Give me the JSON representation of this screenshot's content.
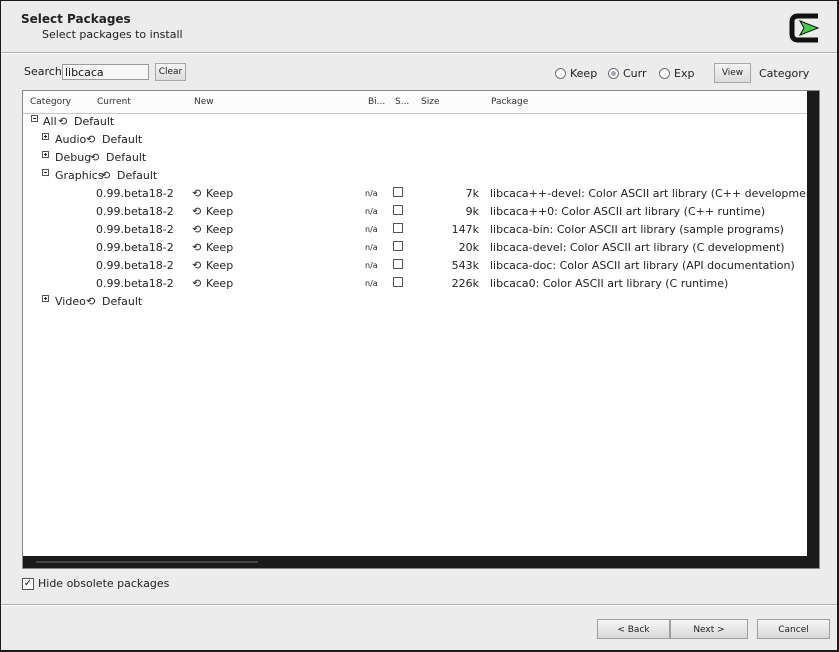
{
  "header": {
    "title": "Select Packages",
    "subtitle": "Select packages to install"
  },
  "toolbar": {
    "search_label": "Search",
    "search_value": "libcaca",
    "clear_label": "Clear",
    "view_options": [
      {
        "label": "Keep",
        "selected": false
      },
      {
        "label": "Curr",
        "selected": true
      },
      {
        "label": "Exp",
        "selected": false
      }
    ],
    "view_button_label": "View",
    "view_mode": "Category"
  },
  "columns": [
    "Category",
    "Current",
    "New",
    "Bi...",
    "S...",
    "Size",
    "Package"
  ],
  "tree": {
    "root": {
      "label": "All",
      "action": "Default",
      "expanded": true
    },
    "categories": [
      {
        "label": "Audio",
        "action": "Default",
        "expanded": false
      },
      {
        "label": "Debug",
        "action": "Default",
        "expanded": false
      },
      {
        "label": "Graphics",
        "action": "Default",
        "expanded": true
      },
      {
        "label": "Video",
        "action": "Default",
        "expanded": false
      }
    ],
    "packages": [
      {
        "current": "0.99.beta18-2",
        "new": "Keep",
        "bin": "n/a",
        "src": false,
        "size": "7k",
        "package": "libcaca++-devel: Color ASCII art library (C++ development)"
      },
      {
        "current": "0.99.beta18-2",
        "new": "Keep",
        "bin": "n/a",
        "src": false,
        "size": "9k",
        "package": "libcaca++0: Color ASCII art library (C++ runtime)"
      },
      {
        "current": "0.99.beta18-2",
        "new": "Keep",
        "bin": "n/a",
        "src": false,
        "size": "147k",
        "package": "libcaca-bin: Color ASCII art library (sample programs)"
      },
      {
        "current": "0.99.beta18-2",
        "new": "Keep",
        "bin": "n/a",
        "src": false,
        "size": "20k",
        "package": "libcaca-devel: Color ASCII art library (C development)"
      },
      {
        "current": "0.99.beta18-2",
        "new": "Keep",
        "bin": "n/a",
        "src": false,
        "size": "543k",
        "package": "libcaca-doc: Color ASCII art library (API documentation)"
      },
      {
        "current": "0.99.beta18-2",
        "new": "Keep",
        "bin": "n/a",
        "src": false,
        "size": "226k",
        "package": "libcaca0: Color ASCII art library (C runtime)"
      }
    ]
  },
  "footer": {
    "hide_obsolete_label": "Hide obsolete packages",
    "hide_obsolete_checked": true,
    "back_label": "< Back",
    "next_label": "Next >",
    "cancel_label": "Cancel"
  },
  "icons": {
    "logo": "cygwin-logo",
    "cycle": "cycle-arrows-icon"
  },
  "colors": {
    "logo_green": "#3fd23f",
    "logo_black": "#111111"
  }
}
